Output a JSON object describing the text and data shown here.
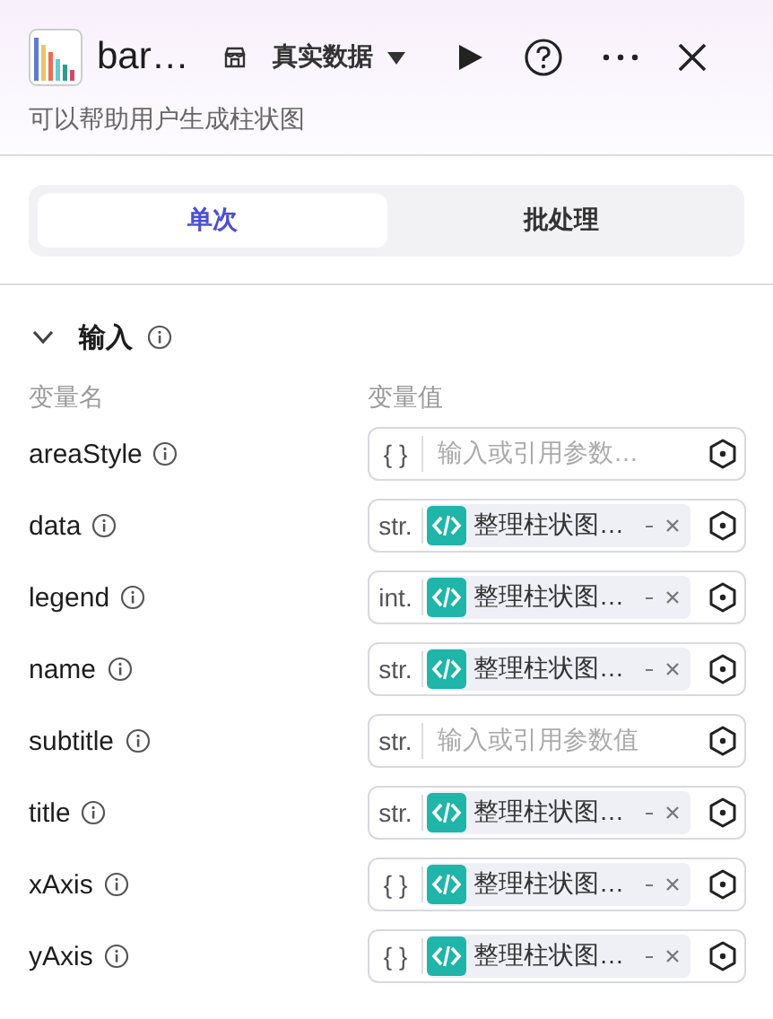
{
  "header": {
    "title": "bar…",
    "mode": "真实数据",
    "description": "可以帮助用户生成柱状图"
  },
  "tabs": [
    {
      "label": "单次",
      "selected": true
    },
    {
      "label": "批处理",
      "selected": false
    }
  ],
  "section": {
    "title": "输入",
    "expanded": true,
    "columns": [
      "变量名",
      "变量值"
    ]
  },
  "variables": [
    {
      "name": "areaStyle",
      "type": "{ }",
      "kind": "empty",
      "placeholder": "输入或引用参数…"
    },
    {
      "name": "data",
      "type": "str.",
      "kind": "ref",
      "value": "整理柱状图…"
    },
    {
      "name": "legend",
      "type": "int.",
      "kind": "ref",
      "value": "整理柱状图…"
    },
    {
      "name": "name",
      "type": "str.",
      "kind": "ref",
      "value": "整理柱状图…"
    },
    {
      "name": "subtitle",
      "type": "str.",
      "kind": "empty",
      "placeholder": "输入或引用参数值"
    },
    {
      "name": "title",
      "type": "str.",
      "kind": "ref",
      "value": "整理柱状图…"
    },
    {
      "name": "xAxis",
      "type": "{ }",
      "kind": "ref",
      "value": "整理柱状图…"
    },
    {
      "name": "yAxis",
      "type": "{ }",
      "kind": "ref",
      "value": "整理柱状图…"
    }
  ]
}
